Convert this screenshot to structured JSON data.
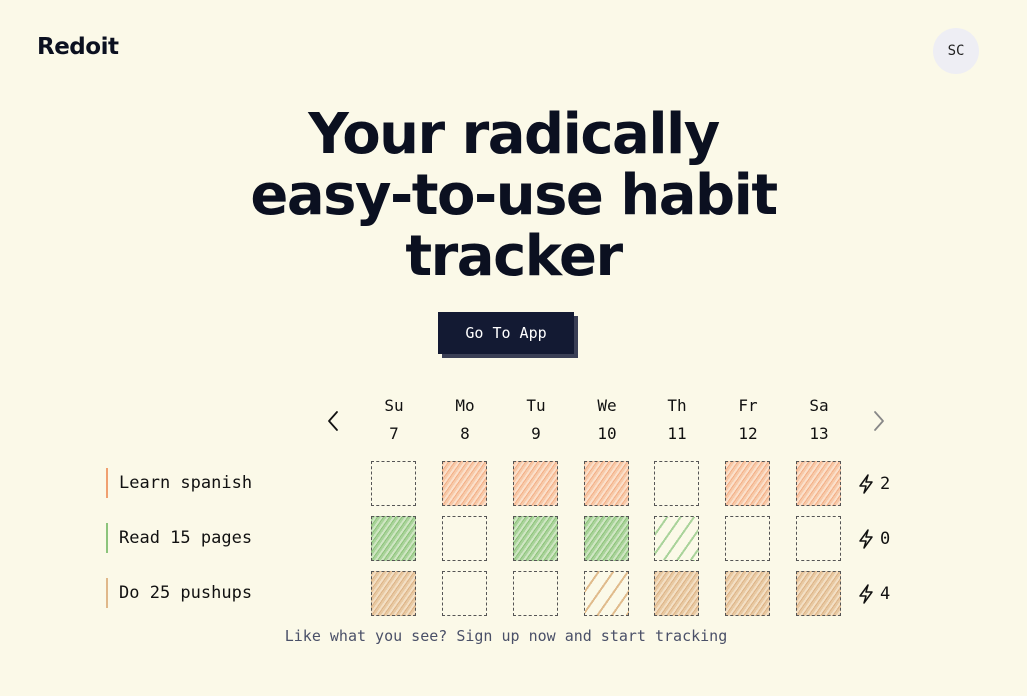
{
  "header": {
    "logo_text": "Redoit",
    "avatar_initials": "SC"
  },
  "hero": {
    "line1": "Your radically",
    "line2": "easy-to-use habit",
    "line3": "tracker"
  },
  "cta": {
    "label": "Go To App"
  },
  "week": {
    "prev_icon": "chevron-left-icon",
    "next_icon": "chevron-right-icon",
    "days": [
      {
        "name": "Su",
        "num": "7"
      },
      {
        "name": "Mo",
        "num": "8"
      },
      {
        "name": "Tu",
        "num": "9"
      },
      {
        "name": "We",
        "num": "10"
      },
      {
        "name": "Th",
        "num": "11"
      },
      {
        "name": "Fr",
        "num": "12"
      },
      {
        "name": "Sa",
        "num": "13"
      }
    ]
  },
  "habits": [
    {
      "name": "Learn spanish",
      "color": "#f0a070",
      "streak": "2",
      "streak_icon": "lightning-icon",
      "cells": [
        "empty",
        "done-orange",
        "done-orange",
        "done-orange",
        "empty",
        "done-orange",
        "done-orange"
      ]
    },
    {
      "name": "Read 15 pages",
      "color": "#8cc47c",
      "streak": "0",
      "streak_icon": "lightning-icon",
      "cells": [
        "done-green",
        "empty",
        "done-green",
        "done-green",
        "partial-green",
        "empty",
        "empty"
      ]
    },
    {
      "name": "Do 25 pushups",
      "color": "#e0b88a",
      "streak": "4",
      "streak_icon": "lightning-icon",
      "cells": [
        "done-tan",
        "empty",
        "empty",
        "partial-tan",
        "done-tan",
        "done-tan",
        "done-tan"
      ]
    }
  ],
  "footer": {
    "signup_text": "Like what you see? Sign up now and start tracking"
  }
}
